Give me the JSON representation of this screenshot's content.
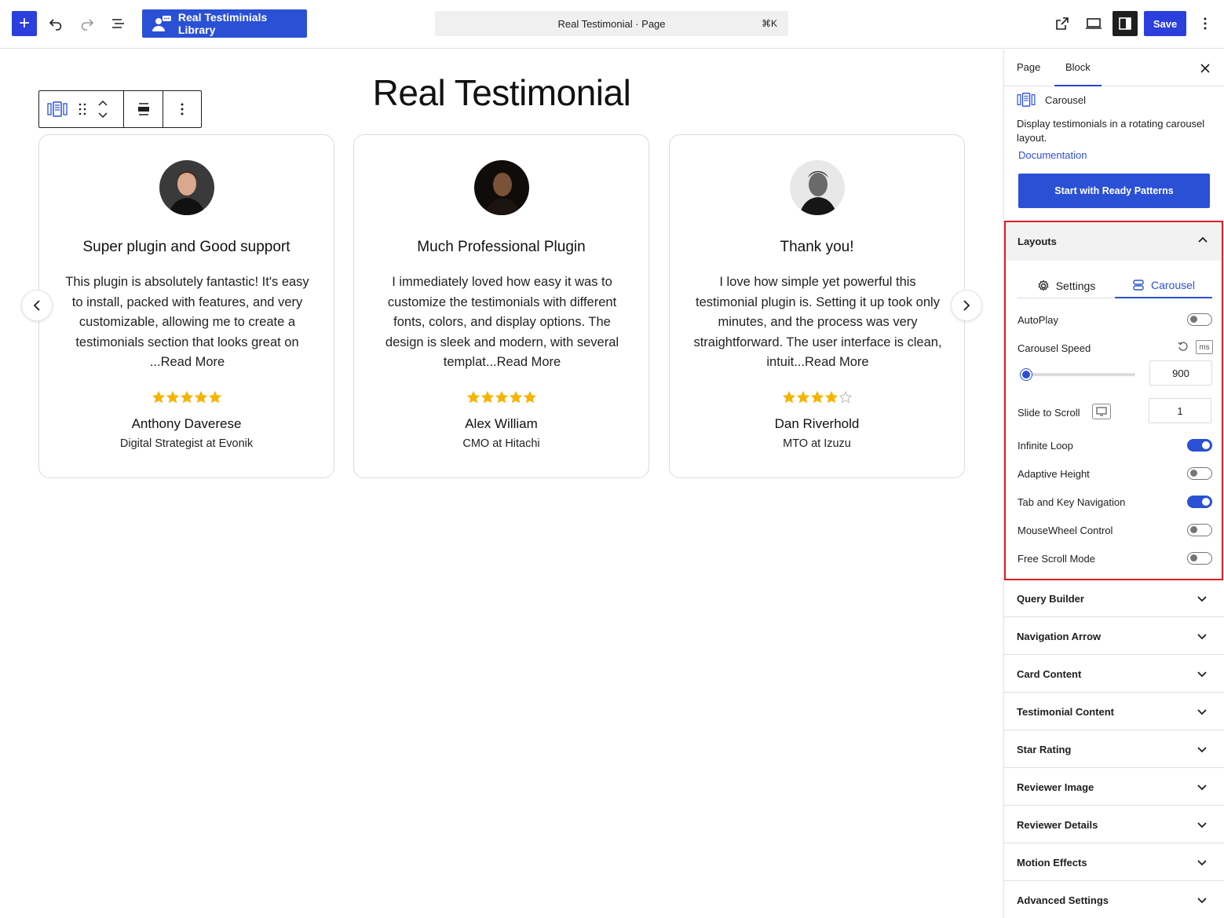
{
  "topbar": {
    "library_label": "Real Testiminials Library",
    "doc_title": "Real Testimonial · Page",
    "shortcut": "⌘K",
    "save_label": "Save"
  },
  "canvas": {
    "title": "Real Testimonial",
    "cards": [
      {
        "title": "Super plugin and Good support",
        "text": "This plugin is absolutely fantastic! It's easy to install, packed with features, and very customizable, allowing me to create a testimonials section that looks great on ...Read More",
        "rating": 5,
        "name": "Anthony Daverese",
        "role": "Digital Strategist at Evonik"
      },
      {
        "title": "Much Professional Plugin",
        "text": "I immediately loved how easy it was to customize the testimonials with different fonts, colors, and display options. The design is sleek and modern, with several templat...Read More",
        "rating": 5,
        "name": "Alex William",
        "role": "CMO at Hitachi"
      },
      {
        "title": "Thank you!",
        "text": "I love how simple yet powerful this testimonial plugin is. Setting it up took only minutes, and the process was very straightforward. The user interface is clean, intuit...Read More",
        "rating": 4,
        "name": "Dan Riverhold",
        "role": "MTO at Izuzu"
      }
    ]
  },
  "sidebar": {
    "tabs": [
      "Page",
      "Block"
    ],
    "block_name": "Carousel",
    "block_description": "Display testimonials in a rotating carousel layout.",
    "documentation_label": "Documentation",
    "patterns_button": "Start with Ready Patterns",
    "layouts": {
      "title": "Layouts",
      "tab_settings": "Settings",
      "tab_carousel": "Carousel",
      "autoplay": {
        "label": "AutoPlay",
        "on": false
      },
      "carousel_speed": {
        "label": "Carousel Speed",
        "value": "900",
        "unit": "ms",
        "slider_fraction": 0.04
      },
      "slide_to_scroll": {
        "label": "Slide to Scroll",
        "value": "1"
      },
      "infinite_loop": {
        "label": "Infinite Loop",
        "on": true
      },
      "adaptive_height": {
        "label": "Adaptive Height",
        "on": false
      },
      "tab_key_navigation": {
        "label": "Tab and Key Navigation",
        "on": true
      },
      "mousewheel_control": {
        "label": "MouseWheel Control",
        "on": false
      },
      "free_scroll_mode": {
        "label": "Free Scroll Mode",
        "on": false
      }
    },
    "panels": [
      "Query Builder",
      "Navigation Arrow",
      "Card Content",
      "Testimonial Content",
      "Star Rating",
      "Reviewer Image",
      "Reviewer Details",
      "Motion Effects",
      "Advanced Settings"
    ]
  },
  "colors": {
    "accent": "#2a50d6",
    "star": "#f5b400",
    "highlight": "#e11d26"
  }
}
